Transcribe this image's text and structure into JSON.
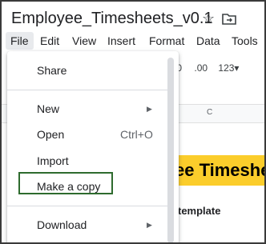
{
  "document": {
    "title": "Employee_Timesheets_v0.1"
  },
  "menubar": {
    "items": [
      "File",
      "Edit",
      "View",
      "Insert",
      "Format",
      "Data",
      "Tools"
    ]
  },
  "toolbar": {
    "decimal_decrease": ".0",
    "decimal_increase": ".00",
    "number_format": "123"
  },
  "sheet": {
    "column_c": "C",
    "banner_text": "ee Timeshe",
    "subtitle_text": "template",
    "banner_color": "#fbcd2b"
  },
  "file_menu": {
    "share": "Share",
    "new": "New",
    "open": "Open",
    "open_shortcut": "Ctrl+O",
    "import": "Import",
    "make_copy": "Make a copy",
    "download": "Download"
  },
  "highlight_color": "#2e6b2e"
}
